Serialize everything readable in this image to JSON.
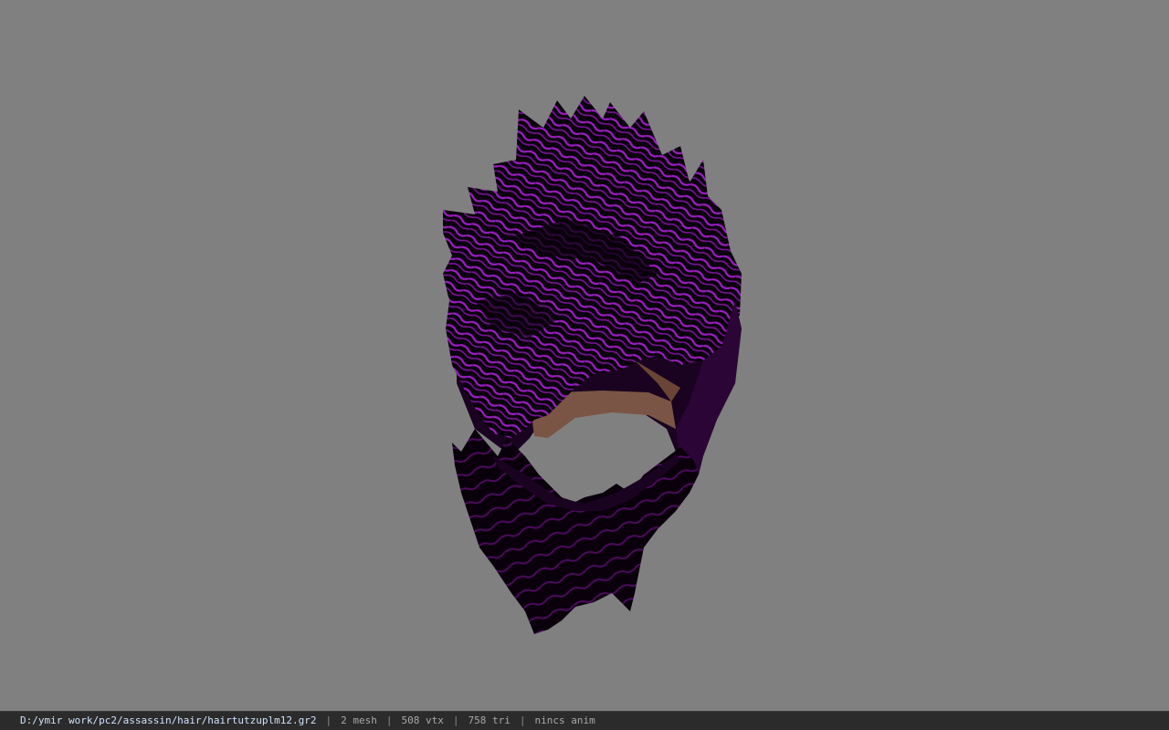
{
  "viewer": {
    "background_color": "#808080",
    "model": {
      "hair_primary_color": "#5a0a6a",
      "hair_highlight_color": "#a020c8",
      "hair_shadow_color": "#0a000c",
      "skin_color": "#7a5545"
    }
  },
  "statusbar": {
    "file_path": "D:/ymir work/pc2/assassin/hair/hairtutzuplm12.gr2",
    "mesh_count": "2 mesh",
    "vertex_count": "508 vtx",
    "triangle_count": "758 tri",
    "anim_status": "nincs anim",
    "separator": "|"
  }
}
